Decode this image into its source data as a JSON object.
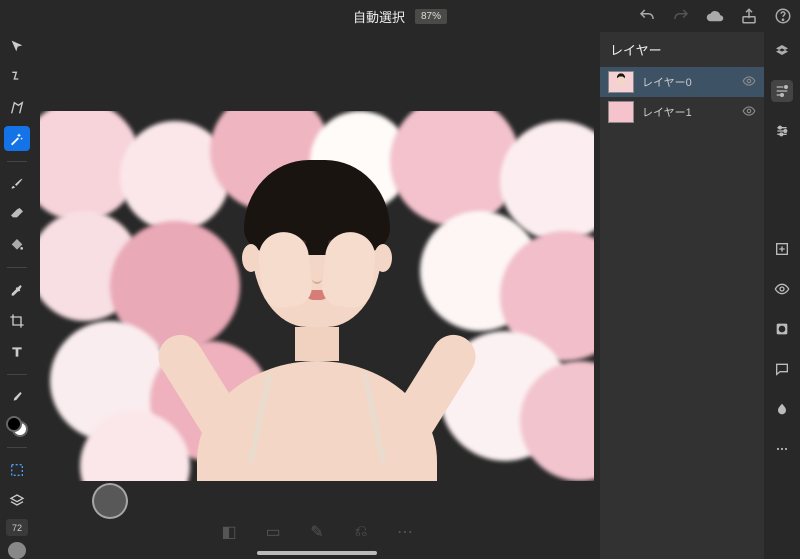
{
  "header": {
    "title": "自動選択",
    "zoom": "87%"
  },
  "toolbar": {
    "brush_size": "72"
  },
  "layers": {
    "title": "レイヤー",
    "items": [
      {
        "name": "レイヤー0"
      },
      {
        "name": "レイヤー1"
      }
    ]
  }
}
